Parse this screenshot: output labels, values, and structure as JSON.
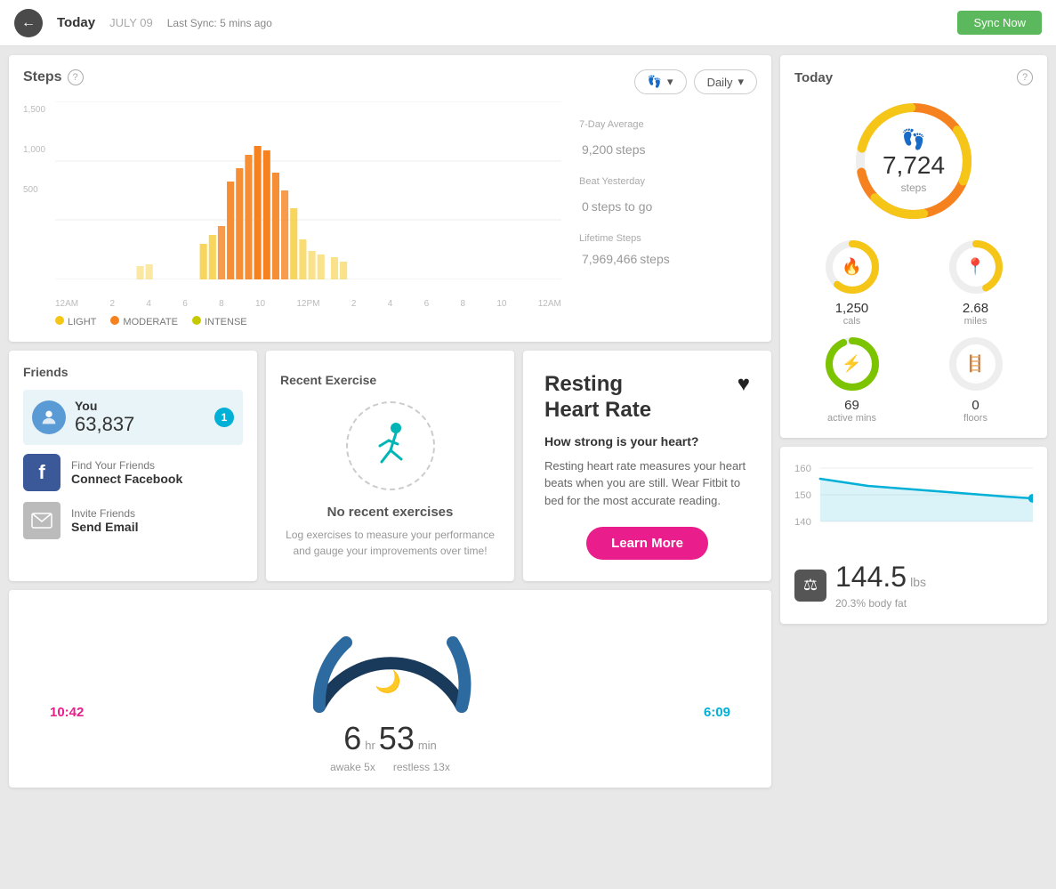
{
  "topbar": {
    "back_label": "←",
    "date_label": "Today",
    "date_sub": "JULY 09",
    "sync_label": "Last Sync: 5 mins ago",
    "sync_button": "Sync Now"
  },
  "steps_card": {
    "title": "Steps",
    "help": "?",
    "chart_legend": [
      {
        "label": "LIGHT",
        "color": "#f5c518"
      },
      {
        "label": "MODERATE",
        "color": "#f5821f"
      },
      {
        "label": "INTENSE",
        "color": "#c8c800"
      }
    ],
    "chart_y_labels": [
      "1,500",
      "1,000",
      "500",
      ""
    ],
    "chart_x_labels": [
      "12AM",
      "2",
      "4",
      "6",
      "8",
      "10",
      "12PM",
      "2",
      "4",
      "6",
      "8",
      "10",
      "12AM"
    ],
    "control_icon": "👣",
    "control_period": "Daily",
    "stats": {
      "avg_label": "7-Day Average",
      "avg_value": "9,200",
      "avg_unit": "steps",
      "beat_label": "Beat Yesterday",
      "beat_value": "0",
      "beat_unit": "steps to go",
      "lifetime_label": "Lifetime Steps",
      "lifetime_value": "7,969,466",
      "lifetime_unit": "steps"
    }
  },
  "friends_card": {
    "title": "Friends",
    "you_label": "You",
    "you_steps": "63,837",
    "you_badge": "1",
    "find_label": "Find Your Friends",
    "find_action": "Connect Facebook",
    "invite_label": "Invite Friends",
    "invite_action": "Send Email"
  },
  "exercise_card": {
    "title": "Recent Exercise",
    "no_data": "No recent exercises",
    "description": "Log exercises to measure your performance and gauge your improvements over time!"
  },
  "heart_card": {
    "title": "Resting\nHeart Rate",
    "sub": "How strong is your heart?",
    "description": "Resting heart rate measures your heart beats when you are still. Wear Fitbit to bed for the most accurate reading.",
    "button": "Learn More",
    "heart_icon": "♥"
  },
  "sleep_card": {
    "start_time": "10:42",
    "end_time": "6:09",
    "hours": "6",
    "hours_unit": "hr",
    "minutes": "53",
    "minutes_unit": "min",
    "awake": "awake 5x",
    "restless": "restless 13x"
  },
  "today_card": {
    "title": "Today",
    "help": "?",
    "steps_value": "7,724",
    "steps_unit": "steps",
    "cals_value": "1,250",
    "cals_unit": "cals",
    "miles_value": "2.68",
    "miles_unit": "miles",
    "active_value": "69",
    "active_unit": "active mins",
    "floors_value": "0",
    "floors_unit": "floors"
  },
  "weight_card": {
    "y_labels": [
      "160",
      "150",
      "140"
    ],
    "value": "144.5",
    "unit": "lbs",
    "body_fat": "20.3% body fat"
  }
}
